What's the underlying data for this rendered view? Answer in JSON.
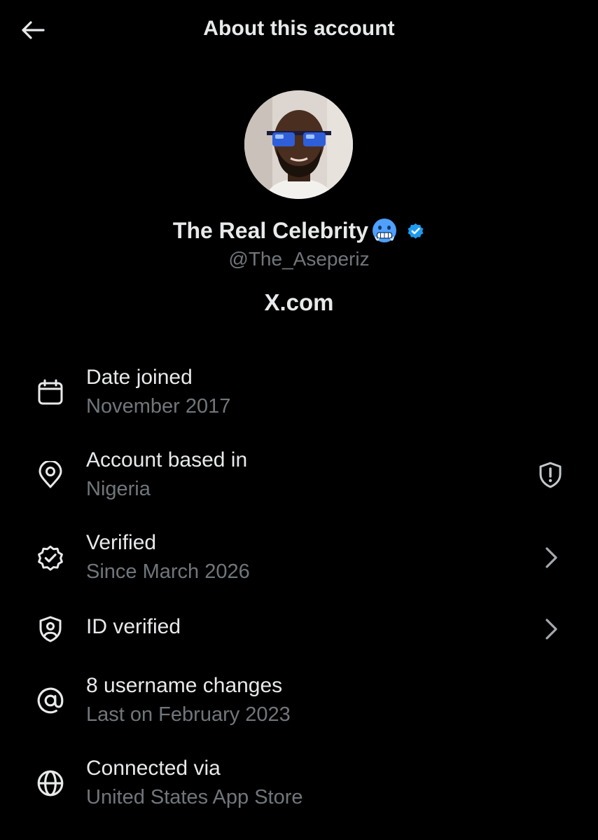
{
  "header": {
    "title": "About this account",
    "back_icon": "arrow-left-icon"
  },
  "profile": {
    "display_name": "The Real Celebrity",
    "emoji": "cold-face-emoji",
    "verified_badge_color": "#1d9bf0",
    "handle": "@The_Aseperiz",
    "site": "X.com"
  },
  "rows": [
    {
      "icon": "calendar-icon",
      "title": "Date joined",
      "subtitle": "November 2017",
      "trailing": null
    },
    {
      "icon": "location-pin-icon",
      "title": "Account based in",
      "subtitle": "Nigeria",
      "trailing": "shield-alert-icon"
    },
    {
      "icon": "verified-badge-outline-icon",
      "title": "Verified",
      "subtitle": "Since March 2026",
      "trailing": "chevron-right-icon"
    },
    {
      "icon": "id-shield-icon",
      "title": "ID verified",
      "subtitle": "",
      "trailing": "chevron-right-icon"
    },
    {
      "icon": "at-sign-icon",
      "title": "8 username changes",
      "subtitle": "Last on February 2023",
      "trailing": null
    },
    {
      "icon": "globe-icon",
      "title": "Connected via",
      "subtitle": "United States App Store",
      "trailing": null
    }
  ],
  "colors": {
    "background": "#000000",
    "primary_text": "#e7e9ea",
    "secondary_text": "#71767b",
    "accent": "#1d9bf0"
  }
}
